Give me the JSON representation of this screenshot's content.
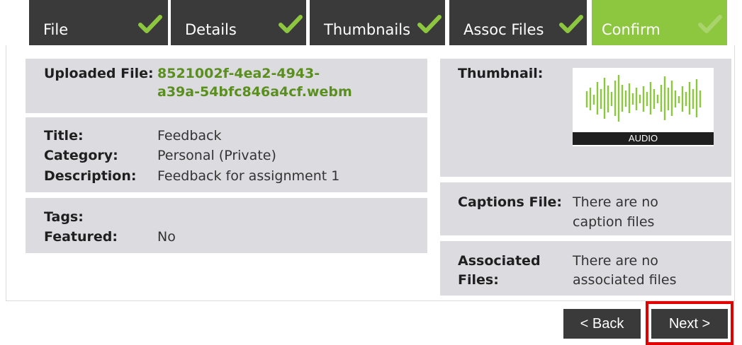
{
  "tabs": [
    {
      "label": "File",
      "done": true
    },
    {
      "label": "Details",
      "done": true
    },
    {
      "label": "Thumbnails",
      "done": true
    },
    {
      "label": "Assoc Files",
      "done": true
    },
    {
      "label": "Confirm",
      "done": false,
      "active": true
    }
  ],
  "file": {
    "label": "Uploaded File:",
    "value_line1": "8521002f-4ea2-4943-",
    "value_line2": "a39a-54bfc846a4cf.webm"
  },
  "details": {
    "title_label": "Title:",
    "title_value": "Feedback",
    "category_label": "Category:",
    "category_value": "Personal (Private)",
    "description_label": "Description:",
    "description_value": "Feedback for assignment 1"
  },
  "tags": {
    "tags_label": "Tags:",
    "tags_value": "",
    "featured_label": "Featured:",
    "featured_value": "No"
  },
  "thumbnail": {
    "label": "Thumbnail:",
    "banner": "AUDIO"
  },
  "captions": {
    "label": "Captions File:",
    "value_line1": "There are no",
    "value_line2": "caption files"
  },
  "assoc": {
    "label_line1": "Associated",
    "label_line2": "Files:",
    "value_line1": "There are no",
    "value_line2": "associated files"
  },
  "buttons": {
    "back": "< Back",
    "next": "Next >"
  },
  "colors": {
    "tab_bg": "#3a3a3a",
    "active_tab": "#8dc63f",
    "check": "#8dc63f",
    "panel": "#dcdce0",
    "link_green": "#5a8f1f",
    "highlight": "#e00000"
  }
}
